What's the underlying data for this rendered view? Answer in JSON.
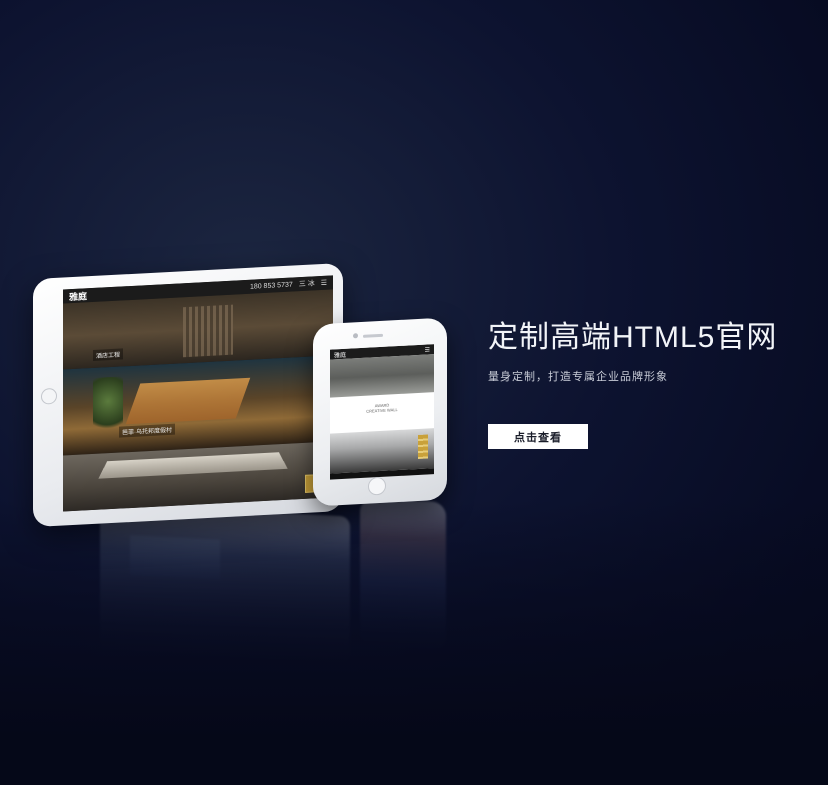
{
  "hero": {
    "title": "定制高端HTML5官网",
    "subtitle": "量身定制，打造专属企业品牌形象",
    "cta_label": "点击查看"
  },
  "tablet_screen": {
    "logo": "雅庭",
    "phone": "180 853 5737",
    "lang": "三 冰",
    "menu_icon": "menu-icon",
    "captions": [
      "酒店工程",
      "芭菲·乌托邦度假村"
    ]
  },
  "phone_screen": {
    "logo": "雅庭",
    "text_lines": [
      "AWARD",
      "CREATIVE WALL"
    ],
    "menu_icon": "menu-icon"
  },
  "colors": {
    "background": "#070b22",
    "button_bg": "#ffffff",
    "title_text": "#f2f4f8",
    "accent_gold": "#c9a13a"
  }
}
